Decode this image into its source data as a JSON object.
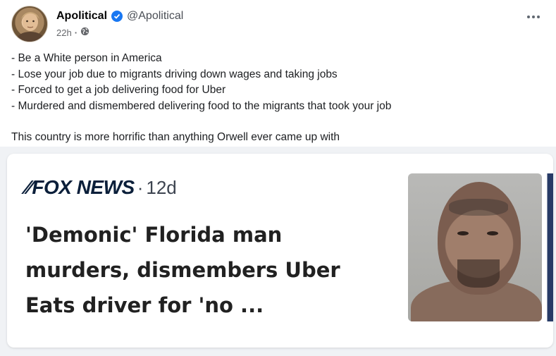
{
  "post": {
    "author_name": "Apolitical",
    "handle": "@Apolitical",
    "timestamp": "22h",
    "separator": "·",
    "audience_icon": "globe-icon",
    "verified_icon": "verified-badge-icon",
    "more_icon": "more-options-icon",
    "lines": [
      "- Be a White person in America",
      "- Lose your job due to migrants driving down wages and taking jobs",
      "- Forced to get a job delivering food for Uber",
      "- Murdered and dismembered delivering food to the migrants that took your job",
      "",
      "This country is more horrific than anything Orwell ever came up with"
    ]
  },
  "card": {
    "source": "FOX NEWS",
    "separator": "·",
    "age": "12d",
    "headline_lines": [
      "'Demonic' Florida man",
      "murders, dismembers Uber",
      "Eats driver for 'no ..."
    ]
  },
  "colors": {
    "verified": "#1877f2",
    "fox_navy": "#0b1f3a",
    "card_bg": "#f0f2f5"
  }
}
